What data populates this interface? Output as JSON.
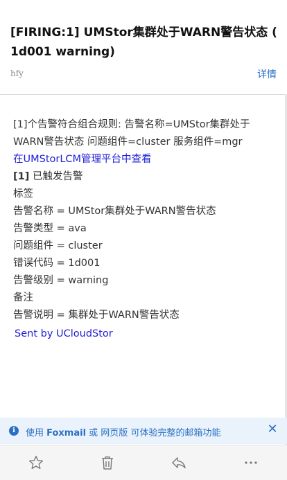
{
  "email": {
    "subject": "[FIRING:1] UMStor集群处于WARN警告状态 ( 1d001 warning)",
    "sender": "hfy",
    "details_label": "详情"
  },
  "body": {
    "intro": "[1]个告警符合组合规则: 告警名称=UMStor集群处于WARN警告状态 问题组件=cluster 服务组件=mgr",
    "view_link": "在UMStorLCM管理平台中查看",
    "triggered_num": "[1]",
    "triggered_text": " 已触发告警",
    "labels_heading": "标签",
    "labels": [
      "告警名称 = UMStor集群处于WARN警告状态",
      "告警类型 = ava",
      "问题组件 = cluster",
      "错误代码 = 1d001",
      "告警级别 = warning"
    ],
    "notes_heading": "备注",
    "notes": [
      "告警说明 = 集群处于WARN警告状态"
    ],
    "signature": "Sent by UCloudStor"
  },
  "banner": {
    "prefix": "使用 ",
    "foxmail": "Foxmail",
    "middle": " 或 网页版 可体验完整的邮箱功能"
  },
  "toolbar": {
    "icons": [
      "star-icon",
      "trash-icon",
      "reply-icon",
      "more-icon"
    ]
  },
  "colors": {
    "link": "#2121d6",
    "accent": "#2b6fc4",
    "banner_bg": "#eaf3fb"
  }
}
